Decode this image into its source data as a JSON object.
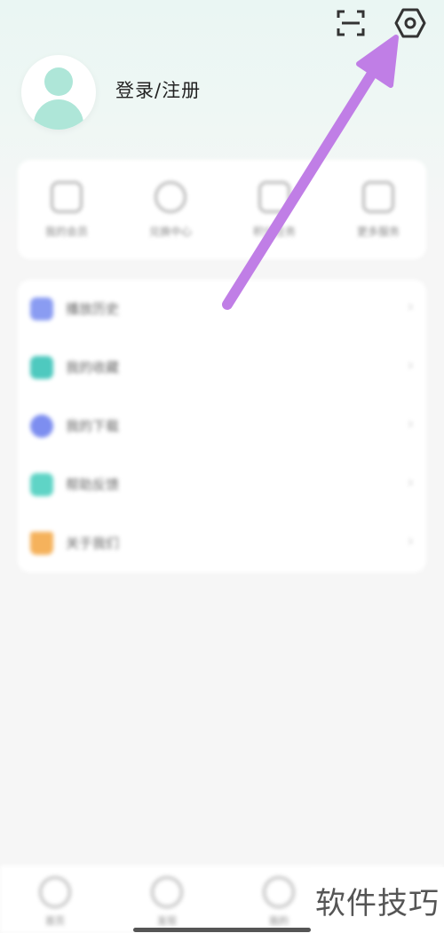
{
  "header": {
    "scan_icon": "scan-icon",
    "settings_icon": "gear-icon",
    "login_label": "登录/注册"
  },
  "quick_actions": [
    {
      "label": "我的会员",
      "icon": "shield-icon"
    },
    {
      "label": "兑换中心",
      "icon": "gift-icon"
    },
    {
      "label": "积分任务",
      "icon": "task-icon"
    },
    {
      "label": "更多服务",
      "icon": "grid-icon"
    }
  ],
  "menu_items": [
    {
      "label": "播放历史",
      "color": "#8a9cf2",
      "chevron": "›"
    },
    {
      "label": "我的收藏",
      "color": "#4ec9bf",
      "chevron": "›"
    },
    {
      "label": "我的下载",
      "color": "#7d8ef0",
      "chevron": "›"
    },
    {
      "label": "帮助反馈",
      "color": "#5fd4c6",
      "chevron": "›"
    },
    {
      "label": "关于我们",
      "color": "#f5b25c",
      "chevron": "›"
    }
  ],
  "bottom_nav": [
    {
      "label": "首页",
      "icon": "home-icon"
    },
    {
      "label": "发现",
      "icon": "discover-icon"
    },
    {
      "label": "我的",
      "icon": "profile-icon"
    }
  ],
  "watermark": "软件技巧",
  "colors": {
    "accent_arrow": "#c07ee6",
    "avatar": "#aee6d8"
  }
}
